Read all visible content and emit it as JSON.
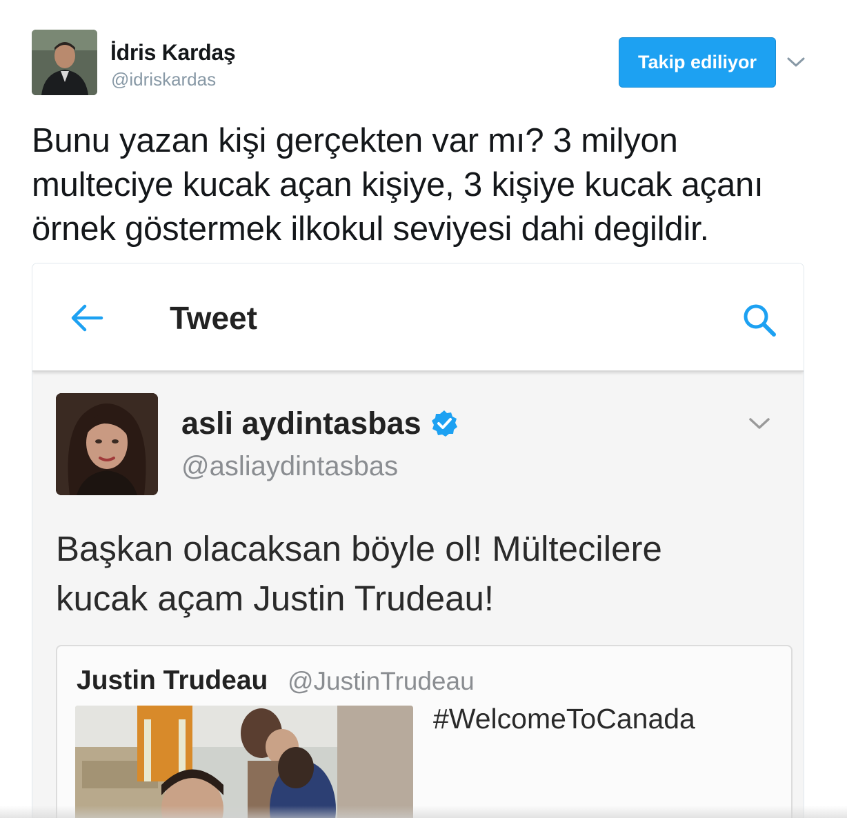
{
  "tweet": {
    "author": {
      "name": "İdris Kardaş",
      "handle": "@idriskardas"
    },
    "follow_button_label": "Takip ediliyor",
    "text": "Bunu yazan kişi gerçekten var mı? 3 milyon\nmulteciye kucak açan kişiye, 3 kişiye kucak açanı\nörnek göstermek ilkokul seviyesi dahi degildir."
  },
  "screenshot": {
    "appbar": {
      "title": "Tweet",
      "back_icon": "arrow-left-icon",
      "search_icon": "search-icon"
    },
    "embedded_tweet": {
      "author_name": "asli aydintasbas",
      "handle": "@asliaydintasbas",
      "verified": true,
      "text": "Başkan olacaksan böyle ol! Mültecilere\nkucak açam Justin Trudeau!",
      "quoted": {
        "author_name": "Justin Trudeau",
        "handle": "@JustinTrudeau",
        "text": "#WelcomeToCanada"
      }
    }
  },
  "colors": {
    "accent": "#1da1f2",
    "handle_gray": "#8899a6",
    "text_dark": "#14171a"
  }
}
